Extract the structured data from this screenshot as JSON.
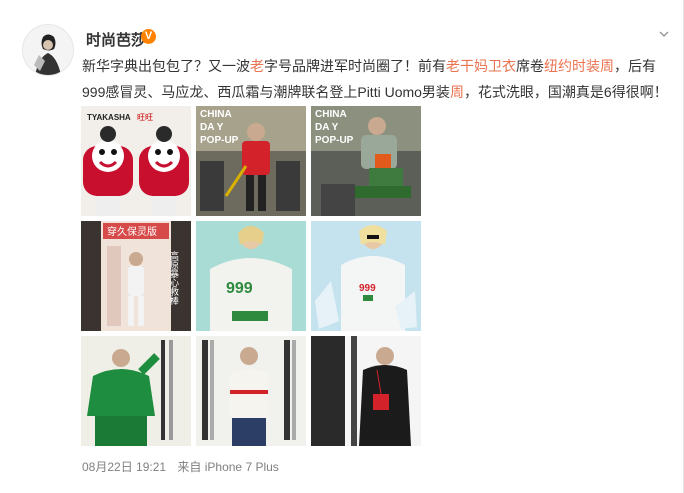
{
  "user": {
    "name": "时尚芭莎",
    "verified_mark": "V"
  },
  "post": {
    "segments": [
      {
        "text": "新华字典出包包了？又一波",
        "highlight": false
      },
      {
        "text": "老",
        "highlight": true
      },
      {
        "text": "字号品牌进军时尚圈了！前有",
        "highlight": false
      },
      {
        "text": "老干妈卫衣",
        "highlight": true
      },
      {
        "text": "席卷",
        "highlight": false
      },
      {
        "text": "纽约时装周",
        "highlight": true
      },
      {
        "text": "，后有999感冒灵、马应龙、西瓜霜与潮牌联名登上Pitti Uomo男装",
        "highlight": false
      },
      {
        "text": "周",
        "highlight": true
      },
      {
        "text": "，花式洗眼，国潮真是6得很啊！",
        "highlight": false
      }
    ]
  },
  "images": {
    "tile1": {
      "top_text": "TYAKASHA",
      "top_text2": "旺旺"
    },
    "tile2": {
      "line1": "CHINA",
      "line2": "DA Y",
      "line3": "POP-UP"
    },
    "tile3": {
      "line1": "CHINA",
      "line2": "DA Y",
      "line3": "POP-UP"
    },
    "tile4": {
      "banner": "穿久保灵版",
      "sign": "高原暴心救棒"
    },
    "tile5": {
      "logo": "999"
    },
    "tile6": {
      "logo": "999"
    }
  },
  "footer": {
    "date": "08月22日 19:21",
    "source": "来自 iPhone 7 Plus"
  },
  "colors": {
    "highlight": "#eb7350",
    "verified": "#ff8200",
    "meta": "#808080"
  }
}
